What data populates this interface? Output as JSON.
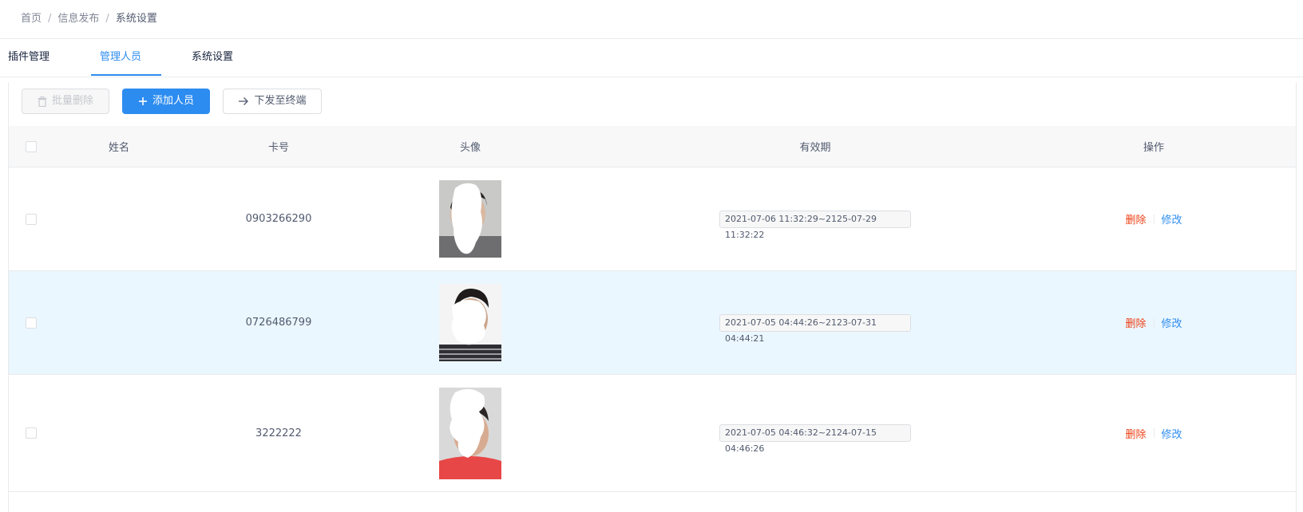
{
  "breadcrumb": {
    "items": [
      "首页",
      "信息发布",
      "系统设置"
    ],
    "separator": "/"
  },
  "tabs": [
    {
      "label": "插件管理",
      "active": false
    },
    {
      "label": "管理人员",
      "active": true
    },
    {
      "label": "系统设置",
      "active": false
    }
  ],
  "toolbar": {
    "batch_delete_label": "批量删除",
    "add_person_label": "添加人员",
    "send_to_terminal_label": "下发至终端"
  },
  "table": {
    "columns": [
      "姓名",
      "卡号",
      "头像",
      "有效期",
      "操作"
    ],
    "rows": [
      {
        "name": "",
        "card": "0903266290",
        "period": "2021-07-06 11:32:29~2125-07-29 11:32:22",
        "delete_label": "删除",
        "edit_label": "修改",
        "highlighted": false
      },
      {
        "name": "",
        "card": "0726486799",
        "period": "2021-07-05 04:44:26~2123-07-31 04:44:21",
        "delete_label": "删除",
        "edit_label": "修改",
        "highlighted": true
      },
      {
        "name": "",
        "card": "3222222",
        "period": "2021-07-05 04:46:32~2124-07-15 04:46:26",
        "delete_label": "删除",
        "edit_label": "修改",
        "highlighted": false
      }
    ]
  },
  "colors": {
    "primary": "#2d8cf0",
    "danger": "#ed4014",
    "row_highlight": "#ebf7ff",
    "header_bg": "#f8f8f9"
  },
  "icons": {
    "batch_delete": "trash-icon",
    "add_person": "plus-icon",
    "send_to_terminal": "arrow-right-icon"
  }
}
